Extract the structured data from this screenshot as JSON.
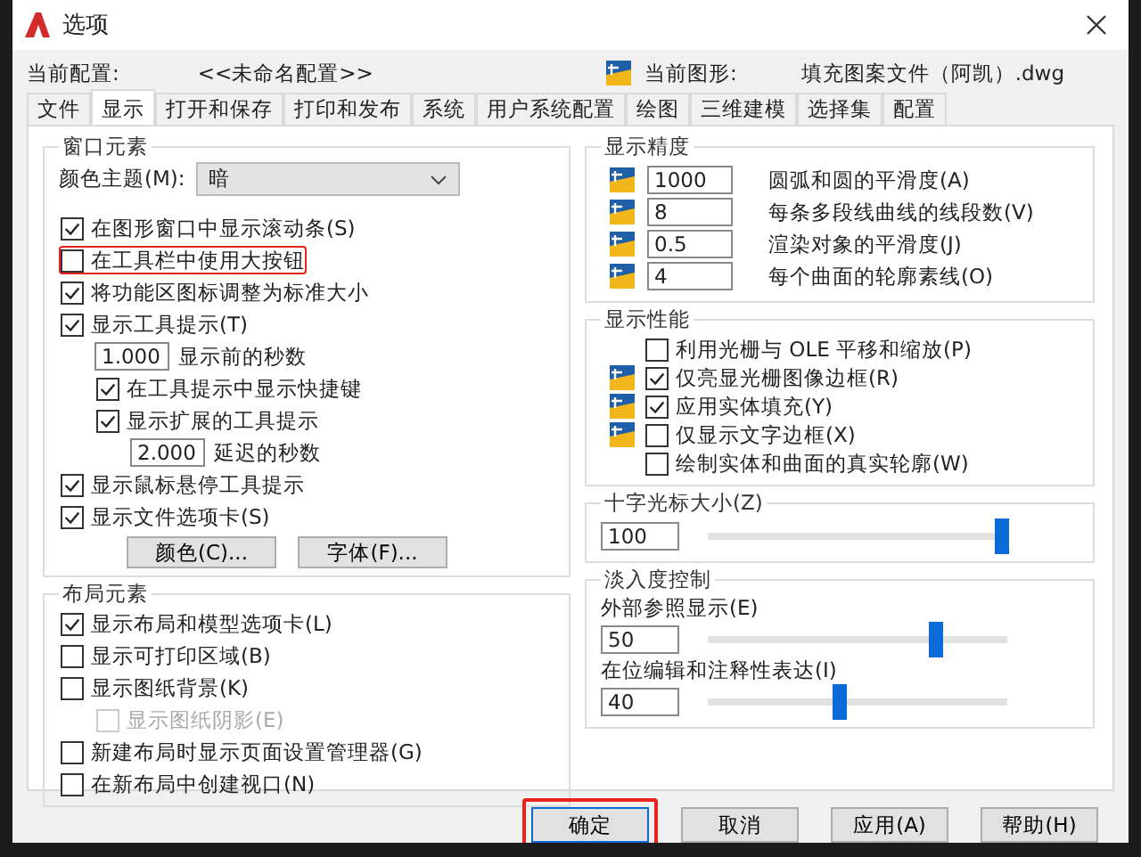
{
  "window": {
    "title": "选项"
  },
  "current_profile": {
    "label": "当前配置:",
    "value": "<<未命名配置>>"
  },
  "current_drawing": {
    "label": "当前图形:",
    "value": "填充图案文件（阿凯）.dwg"
  },
  "tabs": [
    {
      "label": "文件",
      "selected": false
    },
    {
      "label": "显示",
      "selected": true
    },
    {
      "label": "打开和保存",
      "selected": false
    },
    {
      "label": "打印和发布",
      "selected": false
    },
    {
      "label": "系统",
      "selected": false
    },
    {
      "label": "用户系统配置",
      "selected": false
    },
    {
      "label": "绘图",
      "selected": false
    },
    {
      "label": "三维建模",
      "selected": false
    },
    {
      "label": "选择集",
      "selected": false
    },
    {
      "label": "配置",
      "selected": false
    }
  ],
  "window_elements": {
    "title": "窗口元素",
    "color_theme": {
      "label": "颜色主题(M):",
      "value": "暗"
    },
    "options": [
      {
        "kind": "checkbox",
        "label": "在图形窗口中显示滚动条(S)",
        "checked": true,
        "disabled": false,
        "highlighted": false
      },
      {
        "kind": "checkbox",
        "label": "在工具栏中使用大按钮",
        "checked": false,
        "disabled": false,
        "highlighted": true
      },
      {
        "kind": "checkbox",
        "label": "将功能区图标调整为标准大小",
        "checked": true,
        "disabled": false,
        "highlighted": false
      },
      {
        "kind": "checkbox",
        "label": "显示工具提示(T)",
        "checked": true,
        "disabled": false,
        "highlighted": false,
        "children": [
          {
            "kind": "field",
            "value": "1.000",
            "label": "显示前的秒数"
          },
          {
            "kind": "checkbox",
            "label": "在工具提示中显示快捷键",
            "checked": true,
            "disabled": false,
            "highlighted": false
          },
          {
            "kind": "checkbox",
            "label": "显示扩展的工具提示",
            "checked": true,
            "disabled": false,
            "highlighted": false,
            "children": [
              {
                "kind": "field",
                "value": "2.000",
                "label": "延迟的秒数"
              }
            ]
          }
        ]
      },
      {
        "kind": "checkbox",
        "label": "显示鼠标悬停工具提示",
        "checked": true,
        "disabled": false,
        "highlighted": false
      },
      {
        "kind": "checkbox",
        "label": "显示文件选项卡(S)",
        "checked": true,
        "disabled": false,
        "highlighted": false
      }
    ],
    "buttons": [
      "颜色(C)...",
      "字体(F)..."
    ]
  },
  "layout_elements": {
    "title": "布局元素",
    "options": [
      {
        "kind": "checkbox",
        "label": "显示布局和模型选项卡(L)",
        "checked": true,
        "disabled": false,
        "highlighted": false
      },
      {
        "kind": "checkbox",
        "label": "显示可打印区域(B)",
        "checked": false,
        "disabled": false,
        "highlighted": false
      },
      {
        "kind": "checkbox",
        "label": "显示图纸背景(K)",
        "checked": false,
        "disabled": false,
        "highlighted": false,
        "children": [
          {
            "kind": "checkbox",
            "label": "显示图纸阴影(E)",
            "checked": false,
            "disabled": true,
            "highlighted": false
          }
        ]
      },
      {
        "kind": "checkbox",
        "label": "新建布局时显示页面设置管理器(G)",
        "checked": false,
        "disabled": false,
        "highlighted": false
      },
      {
        "kind": "checkbox",
        "label": "在新布局中创建视口(N)",
        "checked": false,
        "disabled": false,
        "highlighted": false
      }
    ]
  },
  "display_resolution": {
    "title": "显示精度",
    "items": [
      {
        "value": "1000",
        "label": "圆弧和圆的平滑度(A)"
      },
      {
        "value": "8",
        "label": "每条多段线曲线的线段数(V)"
      },
      {
        "value": "0.5",
        "label": "渲染对象的平滑度(J)"
      },
      {
        "value": "4",
        "label": "每个曲面的轮廓素线(O)"
      }
    ]
  },
  "display_performance": {
    "title": "显示性能",
    "items": [
      {
        "label": "利用光栅与 OLE 平移和缩放(P)",
        "checked": false,
        "icon": false
      },
      {
        "label": "仅亮显光栅图像边框(R)",
        "checked": true,
        "icon": true
      },
      {
        "label": "应用实体填充(Y)",
        "checked": true,
        "icon": true
      },
      {
        "label": "仅显示文字边框(X)",
        "checked": false,
        "icon": true
      },
      {
        "label": "绘制实体和曲面的真实轮廓(W)",
        "checked": false,
        "icon": false
      }
    ]
  },
  "crosshair_size": {
    "title": "十字光标大小(Z)",
    "value": "100",
    "level": 0.98
  },
  "fade_control": {
    "title": "淡入度控制",
    "items": [
      {
        "label": "外部参照显示(E)",
        "value": "50",
        "level": 0.76
      },
      {
        "label": "在位编辑和注释性表达(I)",
        "value": "40",
        "level": 0.44
      }
    ]
  },
  "footer_buttons": [
    {
      "label": "确定",
      "default": true,
      "highlighted": true
    },
    {
      "label": "取消",
      "default": false,
      "highlighted": false
    },
    {
      "label": "应用(A)",
      "default": false,
      "highlighted": false
    },
    {
      "label": "帮助(H)",
      "default": false,
      "highlighted": false
    }
  ]
}
